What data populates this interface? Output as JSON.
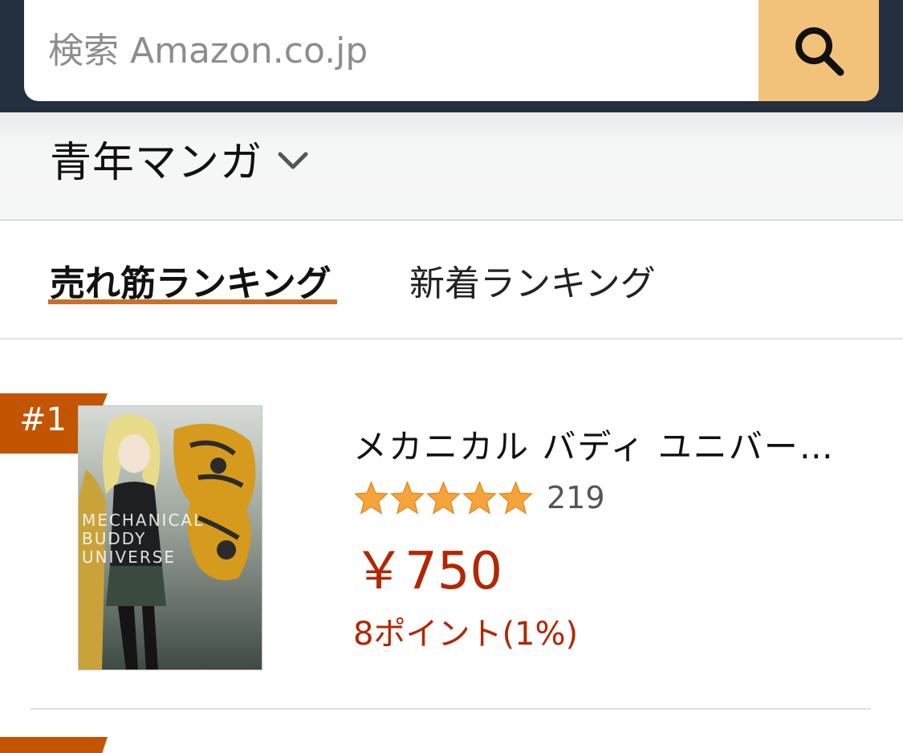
{
  "search": {
    "placeholder": "検索 Amazon.co.jp",
    "button_icon": "search-icon"
  },
  "category": {
    "label": "青年マンガ",
    "icon": "chevron-down-icon"
  },
  "tabs": [
    {
      "label": "売れ筋ランキング",
      "active": true
    },
    {
      "label": "新着ランキング",
      "active": false
    }
  ],
  "products": [
    {
      "rank": "#1",
      "title": "メカニカル バディ ユニバー…",
      "rating": 5,
      "review_count": "219",
      "price": "￥750",
      "points": "8ポイント(1%)",
      "cover_icon": "book-cover-image"
    }
  ],
  "colors": {
    "header_bg": "#232f3e",
    "search_button": "#f3c27a",
    "accent_underline": "#c9702a",
    "rank_badge": "#c45500",
    "price": "#b12704",
    "star": "#f7a33b"
  }
}
